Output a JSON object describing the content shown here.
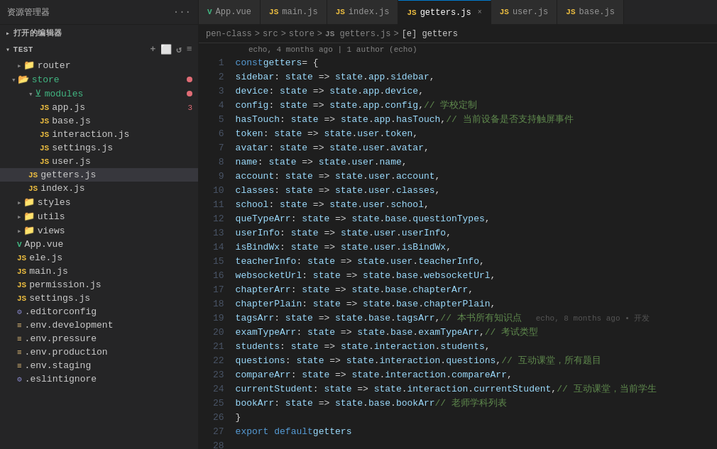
{
  "topbar": {
    "left_title": "资源管理器",
    "open_editors": "打开的编辑器",
    "test_section": "TEST"
  },
  "tabs": [
    {
      "id": "app-vue",
      "icon": "vue",
      "label": "App.vue",
      "active": false,
      "closable": false
    },
    {
      "id": "main-js",
      "icon": "js",
      "label": "main.js",
      "active": false,
      "closable": false
    },
    {
      "id": "index-js",
      "icon": "js",
      "label": "index.js",
      "active": false,
      "closable": false
    },
    {
      "id": "getters-js",
      "icon": "js",
      "label": "getters.js",
      "active": true,
      "closable": true
    },
    {
      "id": "user-js",
      "icon": "js",
      "label": "user.js",
      "active": false,
      "closable": false
    },
    {
      "id": "base-js",
      "icon": "js",
      "label": "base.js",
      "active": false,
      "closable": false
    }
  ],
  "breadcrumb": {
    "parts": [
      "pen-class",
      "src",
      "store",
      "JS getters.js",
      "[e] getters"
    ]
  },
  "editor_meta": {
    "git_info": "echo, 4 months ago | 1 author (echo)"
  },
  "code": {
    "lines": [
      {
        "num": 1,
        "content": "const getters = {"
      },
      {
        "num": 2,
        "content": "    sidebar: state => state.app.sidebar,"
      },
      {
        "num": 3,
        "content": "    device: state => state.app.device,"
      },
      {
        "num": 4,
        "content": "    config: state => state.app.config, // 学校定制"
      },
      {
        "num": 5,
        "content": "    hasTouch: state => state.app.hasTouch, // 当前设备是否支持触屏事件"
      },
      {
        "num": 6,
        "content": "    token: state => state.user.token,"
      },
      {
        "num": 7,
        "content": "    avatar: state => state.user.avatar,"
      },
      {
        "num": 8,
        "content": "    name: state => state.user.name,"
      },
      {
        "num": 9,
        "content": "    account: state => state.user.account,"
      },
      {
        "num": 10,
        "content": "    classes: state => state.user.classes,"
      },
      {
        "num": 11,
        "content": "    school: state => state.user.school,"
      },
      {
        "num": 12,
        "content": "    queTypeArr: state => state.base.questionTypes,"
      },
      {
        "num": 13,
        "content": "    userInfo: state => state.user.userInfo,"
      },
      {
        "num": 14,
        "content": "    isBindWx: state => state.user.isBindWx,"
      },
      {
        "num": 15,
        "content": "    teacherInfo: state => state.user.teacherInfo,"
      },
      {
        "num": 16,
        "content": "    websocketUrl: state => state.base.websocketUrl,"
      },
      {
        "num": 17,
        "content": "    chapterArr: state => state.base.chapterArr,"
      },
      {
        "num": 18,
        "content": "    chapterPlain: state => state.base.chapterPlain,"
      },
      {
        "num": 19,
        "content": "    tagsArr: state => state.base.tagsArr, // 本书所有知识点",
        "ghost": "echo, 8 months ago • 开发"
      },
      {
        "num": 20,
        "content": "    examTypeArr: state => state.base.examTypeArr, // 考试类型"
      },
      {
        "num": 21,
        "content": "    students: state => state.interaction.students,"
      },
      {
        "num": 22,
        "content": "    questions: state => state.interaction.questions, // 互动课堂，所有题目"
      },
      {
        "num": 23,
        "content": "    compareArr: state => state.interaction.compareArr,"
      },
      {
        "num": 24,
        "content": "    currentStudent: state => state.interaction.currentStudent, // 互动课堂，当前学生"
      },
      {
        "num": 25,
        "content": "    bookArr: state => state.base.bookArr // 老师学科列表"
      },
      {
        "num": 26,
        "content": "}"
      },
      {
        "num": 27,
        "content": "export default getters"
      },
      {
        "num": 28,
        "content": ""
      }
    ]
  },
  "sidebar": {
    "files": [
      {
        "type": "folder",
        "label": "modules",
        "depth": 2,
        "open": true,
        "badge": "dot"
      },
      {
        "type": "js",
        "label": "app.js",
        "depth": 3,
        "badge": "3"
      },
      {
        "type": "js",
        "label": "base.js",
        "depth": 3
      },
      {
        "type": "js",
        "label": "interaction.js",
        "depth": 3
      },
      {
        "type": "js",
        "label": "settings.js",
        "depth": 3
      },
      {
        "type": "js",
        "label": "user.js",
        "depth": 3
      },
      {
        "type": "js",
        "label": "getters.js",
        "depth": 2,
        "active": true
      },
      {
        "type": "js",
        "label": "index.js",
        "depth": 2
      },
      {
        "type": "folder",
        "label": "styles",
        "depth": 1,
        "open": false
      },
      {
        "type": "folder",
        "label": "utils",
        "depth": 1,
        "open": false
      },
      {
        "type": "folder",
        "label": "views",
        "depth": 1,
        "open": false
      },
      {
        "type": "vue",
        "label": "App.vue",
        "depth": 1
      },
      {
        "type": "js",
        "label": "ele.js",
        "depth": 1
      },
      {
        "type": "js",
        "label": "main.js",
        "depth": 1
      },
      {
        "type": "js",
        "label": "permission.js",
        "depth": 1
      },
      {
        "type": "js",
        "label": "settings.js",
        "depth": 1
      },
      {
        "type": "config",
        "label": ".editorconfig",
        "depth": 1
      },
      {
        "type": "env",
        "label": ".env.development",
        "depth": 1
      },
      {
        "type": "env",
        "label": ".env.pressure",
        "depth": 1
      },
      {
        "type": "env",
        "label": ".env.production",
        "depth": 1
      },
      {
        "type": "env",
        "label": ".env.staging",
        "depth": 1
      },
      {
        "type": "config",
        "label": ".eslintignore",
        "depth": 1
      }
    ]
  }
}
